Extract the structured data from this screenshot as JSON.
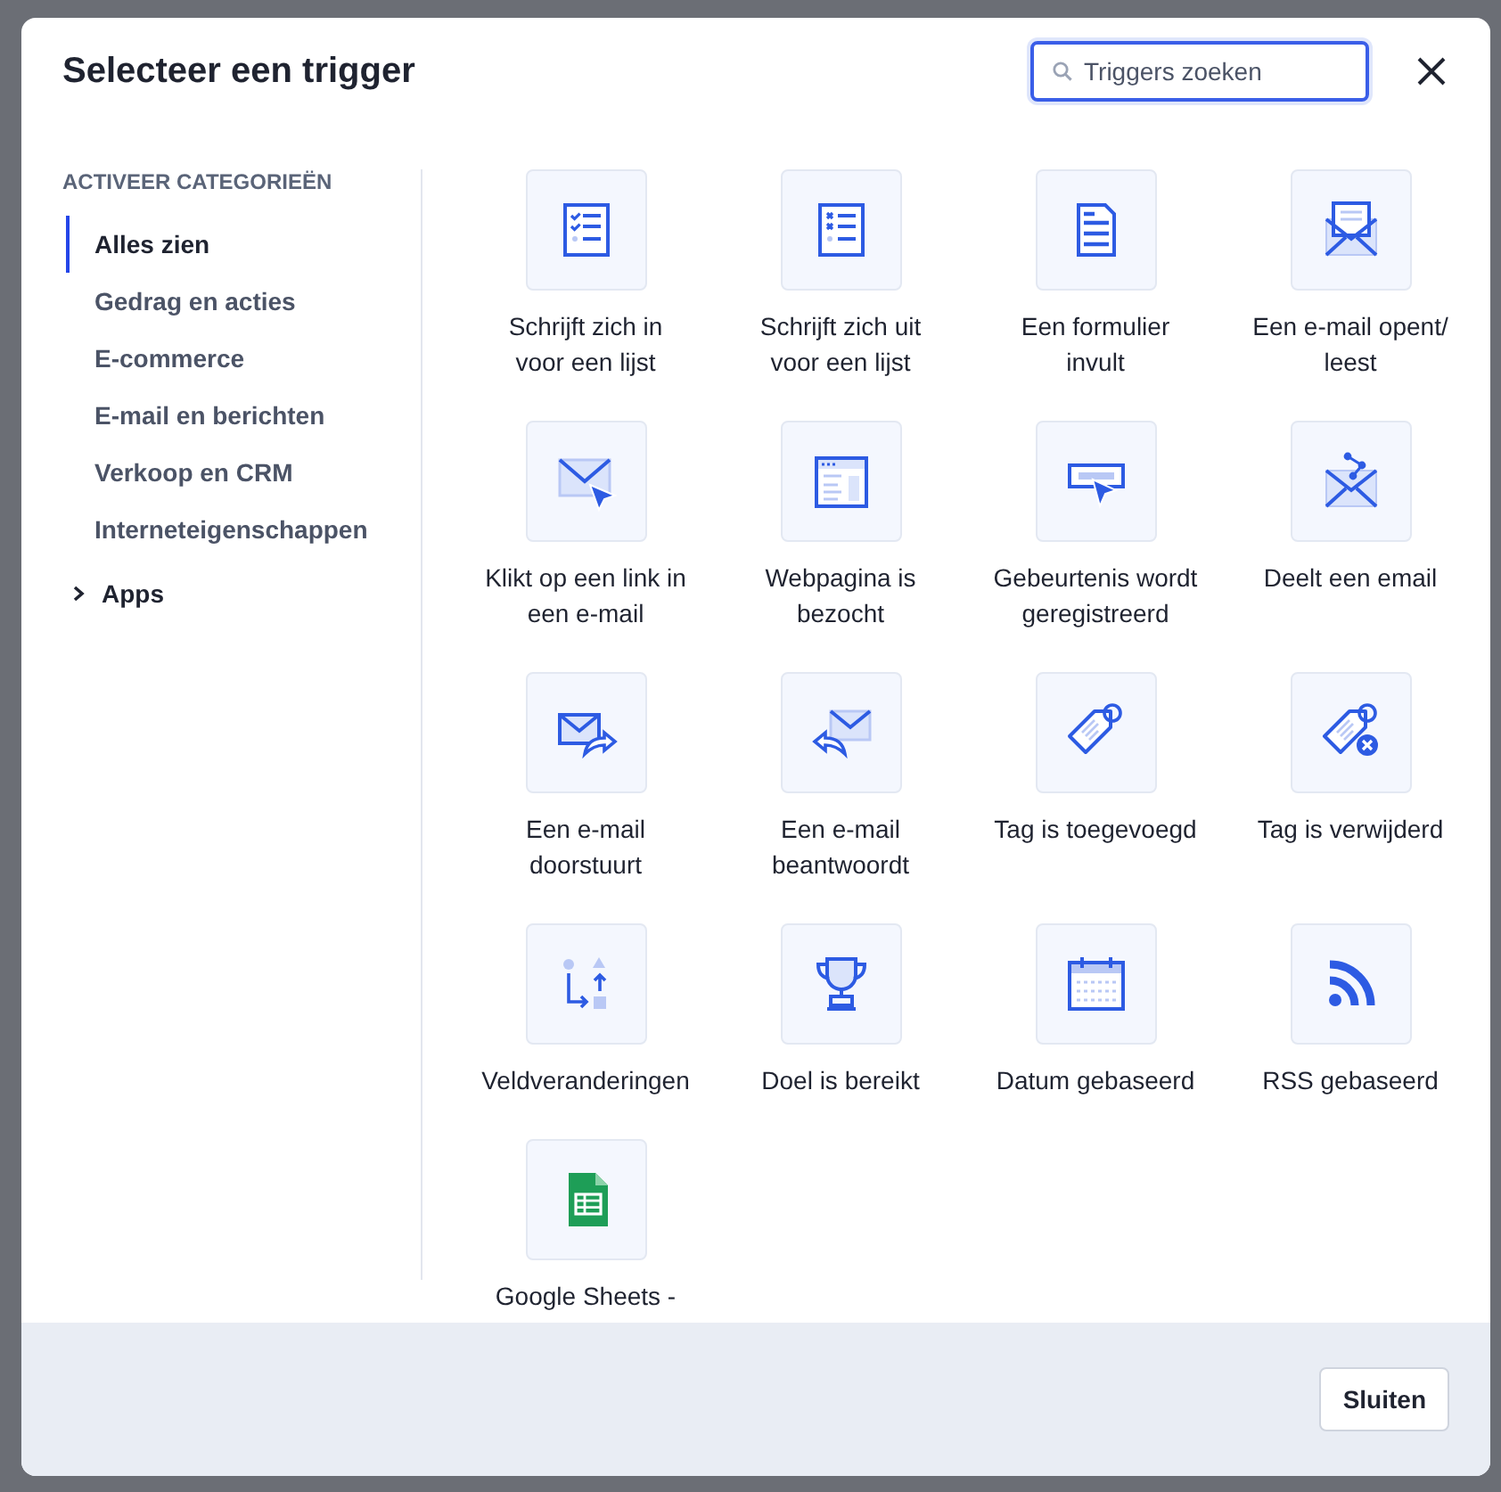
{
  "dialog": {
    "title": "Selecteer een trigger",
    "search": {
      "placeholder": "Triggers zoeken"
    }
  },
  "sidebar": {
    "heading": "ACTIVEER CATEGORIEËN",
    "items": [
      {
        "label": "Alles zien",
        "selected": true
      },
      {
        "label": "Gedrag en acties",
        "selected": false
      },
      {
        "label": "E-commerce",
        "selected": false
      },
      {
        "label": "E-mail en berichten",
        "selected": false
      },
      {
        "label": "Verkoop en CRM",
        "selected": false
      },
      {
        "label": "Interneteigenschappen",
        "selected": false
      }
    ],
    "group": {
      "label": "Apps",
      "expanded": false
    }
  },
  "triggers": [
    {
      "label": "Schrijft zich in voor een lijst",
      "kind": "list-check"
    },
    {
      "label": "Schrijft zich uit voor een lijst",
      "kind": "list-cross"
    },
    {
      "label": "Een formulier invult",
      "kind": "form"
    },
    {
      "label": "Een e-mail opent/ leest",
      "kind": "email-open"
    },
    {
      "label": "Klikt op een link in een e-mail",
      "kind": "email-click"
    },
    {
      "label": "Webpagina is bezocht",
      "kind": "webpage"
    },
    {
      "label": "Gebeurtenis wordt geregistreerd",
      "kind": "event"
    },
    {
      "label": "Deelt een email",
      "kind": "email-share"
    },
    {
      "label": "Een e-mail doorstuurt",
      "kind": "email-forward"
    },
    {
      "label": "Een e-mail beantwoordt",
      "kind": "email-reply"
    },
    {
      "label": "Tag is toegevoegd",
      "kind": "tag-add"
    },
    {
      "label": "Tag is verwijderd",
      "kind": "tag-remove"
    },
    {
      "label": "Veldveranderingen",
      "kind": "field-change"
    },
    {
      "label": "Doel is bereikt",
      "kind": "trophy"
    },
    {
      "label": "Datum gebaseerd",
      "kind": "calendar"
    },
    {
      "label": "RSS gebaseerd",
      "kind": "rss"
    },
    {
      "label": "Google Sheets -",
      "kind": "sheets"
    }
  ],
  "footer": {
    "close_button": "Sluiten"
  }
}
